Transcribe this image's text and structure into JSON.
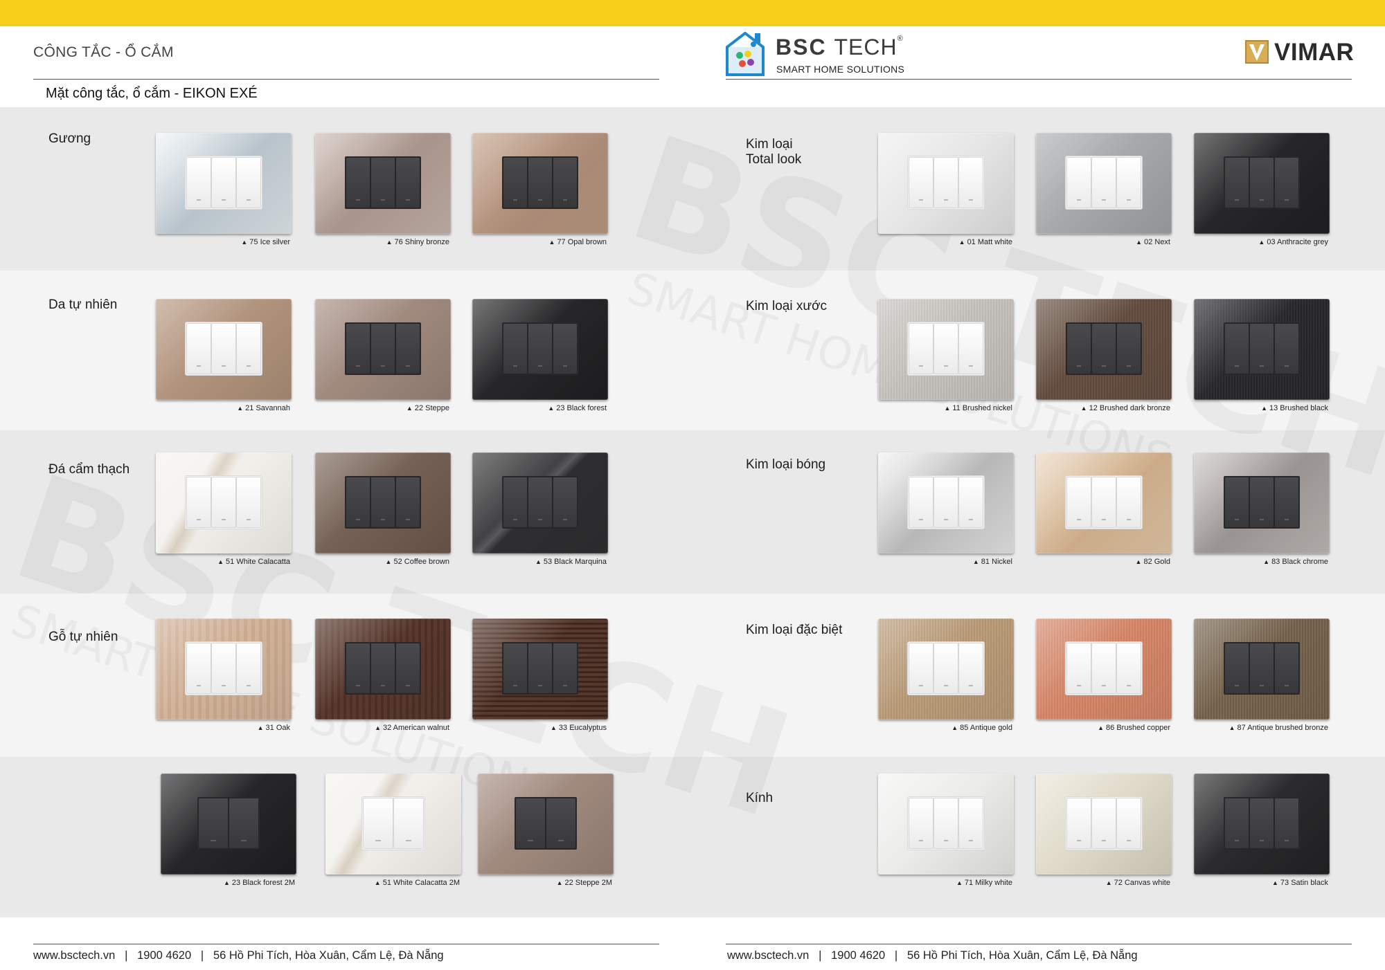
{
  "header": {
    "section_title": "CÔNG TẮC - Ổ CẮM",
    "subtitle": "Mặt công tắc, ổ cắm - EIKON EXÉ",
    "brand": {
      "name_bold": "BSC",
      "name_thin": "TECH",
      "reg": "®",
      "tagline": "SMART HOME SOLUTIONS"
    },
    "partner": {
      "name": "VIMAR"
    }
  },
  "colors": {
    "topbar": "#f7cf1a",
    "band_light": "#e9e9ea",
    "band_lighter": "#f3f3f4"
  },
  "left_groups": [
    {
      "title": "Gương",
      "items": [
        {
          "code": "75",
          "name": "Ice silver",
          "bg": "linear-gradient(135deg,#eef3f6,#b9c4cc 50%,#dfe6ea)",
          "keys": "white"
        },
        {
          "code": "76",
          "name": "Shiny bronze",
          "bg": "linear-gradient(135deg,#cdbcb4,#a8958c 50%,#c4b2a9)",
          "keys": "dark"
        },
        {
          "code": "77",
          "name": "Opal brown",
          "bg": "linear-gradient(135deg,#c4a48e,#ae8d78 60%,#b9987f)",
          "keys": "dark"
        }
      ]
    },
    {
      "title": "Da tự nhiên",
      "items": [
        {
          "code": "21",
          "name": "Savannah",
          "bg": "linear-gradient(135deg,#b89a83,#a98c75)",
          "keys": "white"
        },
        {
          "code": "22",
          "name": "Steppe",
          "bg": "linear-gradient(135deg,#a89185,#968175)",
          "keys": "dark"
        },
        {
          "code": "23",
          "name": "Black forest",
          "bg": "linear-gradient(135deg,#2e2e30,#1e1e20)",
          "keys": "dark"
        }
      ]
    },
    {
      "title": "Đá cẩm thạch",
      "items": [
        {
          "code": "51",
          "name": "White Calacatta",
          "bg": "linear-gradient(120deg,#f4f2ee 30%,#d9cfc1 38%,#f2efea 46%,#f0ede8)",
          "keys": "white"
        },
        {
          "code": "52",
          "name": "Coffee brown",
          "bg": "linear-gradient(135deg,#7e6a5d,#6a574b)",
          "keys": "dark"
        },
        {
          "code": "53",
          "name": "Black Marquina",
          "bg": "linear-gradient(135deg,#3b3b3d 40%,#5a5a5c 45%,#2e2e30 50%)",
          "keys": "dark"
        }
      ]
    },
    {
      "title": "Gỗ tự nhiên",
      "items": [
        {
          "code": "31",
          "name": "Oak",
          "bg": "repeating-linear-gradient(90deg,#d2b49b 0 6px,#c9a88d 6px 11px)",
          "keys": "white"
        },
        {
          "code": "32",
          "name": "American walnut",
          "bg": "repeating-linear-gradient(90deg,#5b3a2e 0 5px,#4d3026 5px 9px)",
          "keys": "dark"
        },
        {
          "code": "33",
          "name": "Eucalyptus",
          "bg": "repeating-linear-gradient(0deg,#5a3a2e 0 4px,#3d261d 4px 7px)",
          "keys": "dark"
        }
      ]
    }
  ],
  "left_bottom": [
    {
      "code": "23",
      "name": "Black forest 2M",
      "bg": "linear-gradient(135deg,#2e2e30,#1e1e20)",
      "keys": "dark"
    },
    {
      "code": "51",
      "name": "White Calacatta 2M",
      "bg": "linear-gradient(120deg,#f4f2ee 30%,#d9cfc1 38%,#f2efea 46%,#f0ede8)",
      "keys": "white"
    },
    {
      "code": "22",
      "name": "Steppe 2M",
      "bg": "linear-gradient(135deg,#a89185,#968175)",
      "keys": "dark"
    }
  ],
  "right_groups": [
    {
      "title": "Kim loại",
      "title2": "Total look",
      "items": [
        {
          "code": "01",
          "name": "Matt white",
          "bg": "linear-gradient(135deg,#eeeeee,#dedede)",
          "keys": "white"
        },
        {
          "code": "02",
          "name": "Next",
          "bg": "linear-gradient(135deg,#aeb0b2,#9d9fa1)",
          "keys": "white"
        },
        {
          "code": "03",
          "name": "Anthracite grey",
          "bg": "linear-gradient(135deg,#2c2c2e,#1f1f21)",
          "keys": "dark"
        }
      ]
    },
    {
      "title": "Kim loại xước",
      "title2": "",
      "items": [
        {
          "code": "11",
          "name": "Brushed nickel",
          "bg": "repeating-linear-gradient(90deg,#c9c6c1 0 2px,#bdbab5 2px 4px)",
          "keys": "white"
        },
        {
          "code": "12",
          "name": "Brushed dark bronze",
          "bg": "repeating-linear-gradient(90deg,#6b5446 0 2px,#5e4a3d 2px 4px)",
          "keys": "dark"
        },
        {
          "code": "13",
          "name": "Brushed black",
          "bg": "repeating-linear-gradient(90deg,#303033 0 2px,#262629 2px 4px)",
          "keys": "dark"
        }
      ]
    },
    {
      "title": "Kim loại bóng",
      "title2": "",
      "items": [
        {
          "code": "81",
          "name": "Nickel",
          "bg": "linear-gradient(135deg,#f2f2f2,#b9b9b9 50%,#e4e4e4)",
          "keys": "white"
        },
        {
          "code": "82",
          "name": "Gold",
          "bg": "linear-gradient(135deg,#ead7c0,#cfae8a 55%,#e0c6a6)",
          "keys": "white"
        },
        {
          "code": "83",
          "name": "Black chrome",
          "bg": "linear-gradient(135deg,#c9c4c2,#9a9492 50%,#bdb7b4)",
          "keys": "dark"
        }
      ]
    },
    {
      "title": "Kim loại đặc biệt",
      "title2": "",
      "items": [
        {
          "code": "85",
          "name": "Antique gold",
          "bg": "repeating-linear-gradient(90deg,#bea17c 0 2px,#b09372 2px 4px)",
          "keys": "white"
        },
        {
          "code": "86",
          "name": "Brushed copper",
          "bg": "repeating-linear-gradient(90deg,#d98c6e 0 2px,#cc7f62 2px 4px)",
          "keys": "white"
        },
        {
          "code": "87",
          "name": "Antique brushed bronze",
          "bg": "repeating-linear-gradient(90deg,#6d5c48 0 2px,#7e6b54 2px 4px)",
          "keys": "dark"
        }
      ]
    },
    {
      "title": "Kính",
      "title2": "",
      "items": [
        {
          "code": "71",
          "name": "Milky white",
          "bg": "linear-gradient(135deg,#f3f3f1,#e3e3df)",
          "keys": "white"
        },
        {
          "code": "72",
          "name": "Canvas white",
          "bg": "linear-gradient(135deg,#e9e4d5,#d6cfbd)",
          "keys": "white"
        },
        {
          "code": "73",
          "name": "Satin black",
          "bg": "linear-gradient(135deg,#323234,#222224)",
          "keys": "dark"
        }
      ]
    }
  ],
  "footer": {
    "website": "www.bsctech.vn",
    "sep": "|",
    "phone": "1900 4620",
    "address": "56 Hồ Phi Tích, Hòa Xuân, Cẩm Lệ, Đà Nẵng"
  },
  "watermark": {
    "text": "BSC TECH",
    "sub": "SMART HOME SOLUTIONS",
    "reg": "®"
  }
}
